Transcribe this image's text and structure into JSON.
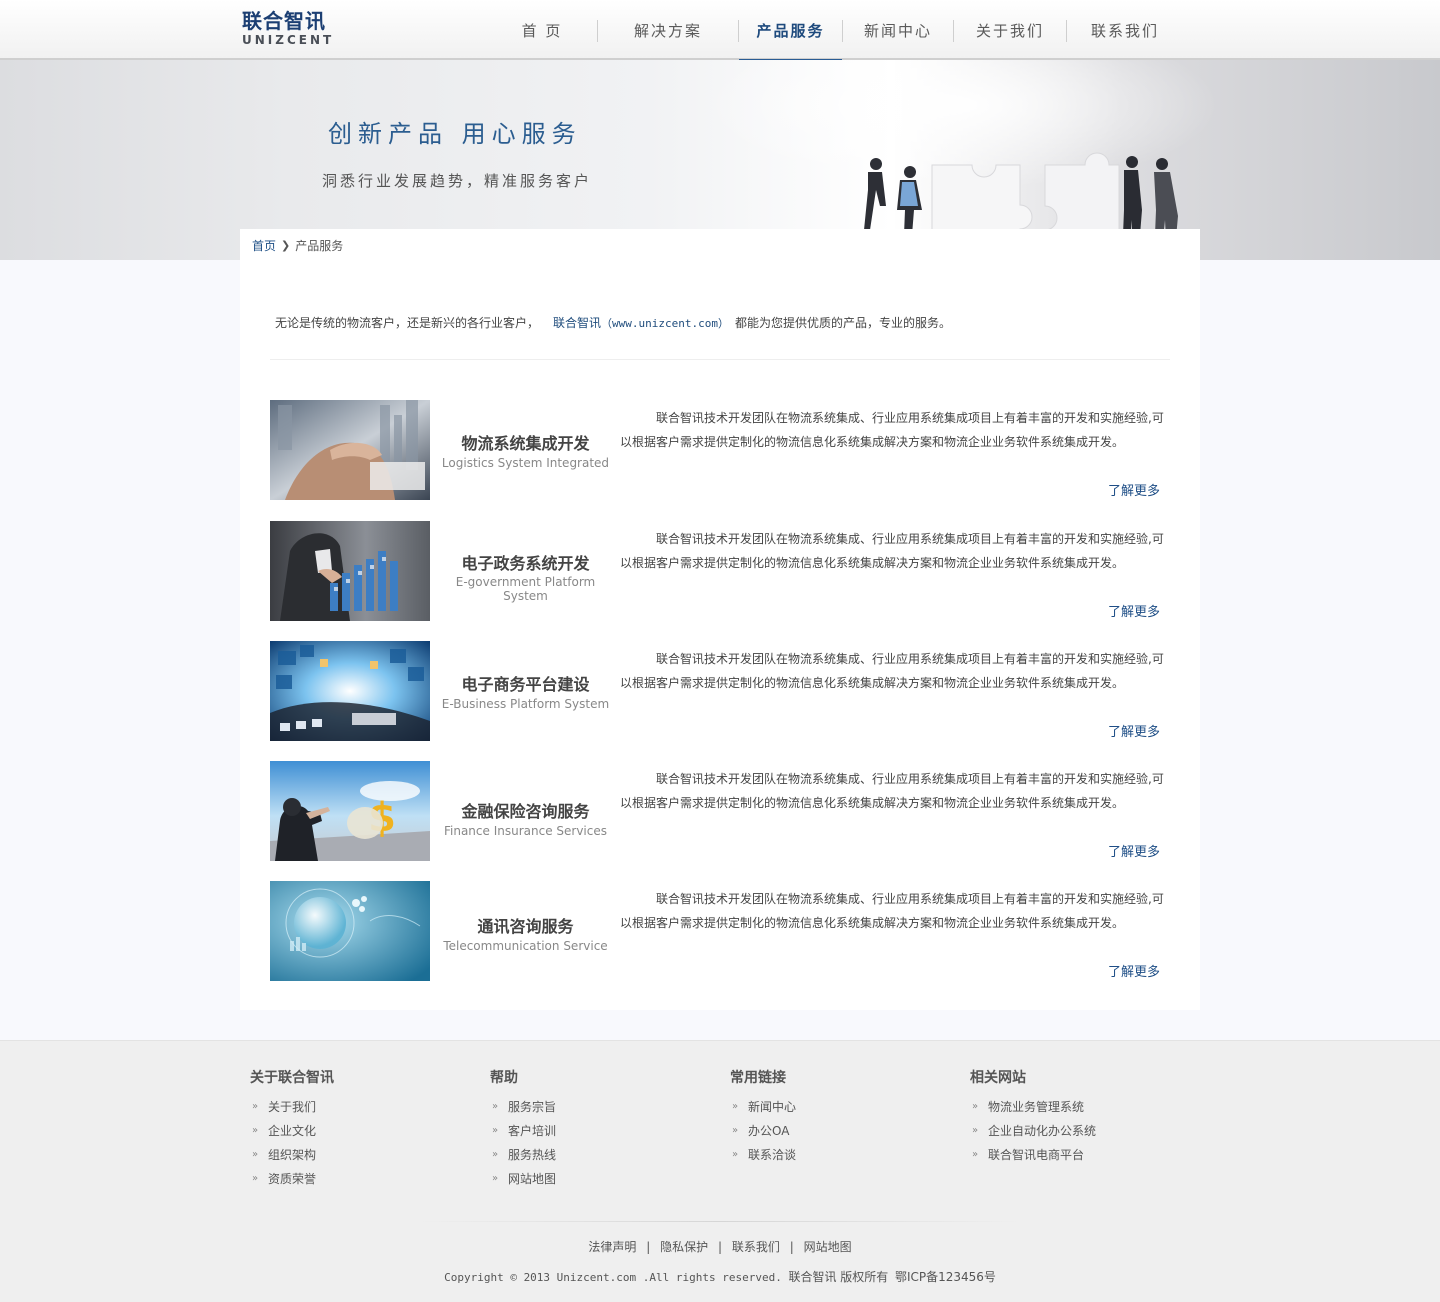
{
  "logo": {
    "cn": "联合智讯",
    "en": "UNIZCENT"
  },
  "nav": [
    {
      "label": "首 页"
    },
    {
      "label": "解决方案"
    },
    {
      "label": "产品服务",
      "active": true
    },
    {
      "label": "新闻中心"
    },
    {
      "label": "关于我们"
    },
    {
      "label": "联系我们"
    }
  ],
  "banner": {
    "slogan_main": "创新产品  用心服务",
    "slogan_sub": "洞悉行业发展趋势，精准服务客户"
  },
  "breadcrumb": {
    "home": "首页",
    "current": "产品服务"
  },
  "intro": {
    "before": "无论是传统的物流客户，还是新兴的各行业客户，",
    "brand_cn": "联合智讯",
    "brand_url": "（www.unizcent.com）",
    "after": "都能为您提供优质的产品，专业的服务。"
  },
  "services": [
    {
      "title_cn": "物流系统集成开发",
      "title_en": "Logistics System Integrated",
      "desc": "联合智讯技术开发团队在物流系统集成、行业应用系统集成项目上有着丰富的开发和实施经验,可以根据客户需求提供定制化的物流信息化系统集成解决方案和物流企业业务软件系统集成开发。",
      "more": "了解更多",
      "image": "logistics-hand-photo"
    },
    {
      "title_cn": "电子政务系统开发",
      "title_en": "E-government Platform System",
      "desc": "联合智讯技术开发团队在物流系统集成、行业应用系统集成项目上有着丰富的开发和实施经验,可以根据客户需求提供定制化的物流信息化系统集成解决方案和物流企业业务软件系统集成开发。",
      "more": "了解更多",
      "image": "egovernment-chart-photo"
    },
    {
      "title_cn": "电子商务平台建设",
      "title_en": "E-Business Platform System",
      "desc": "联合智讯技术开发团队在物流系统集成、行业应用系统集成项目上有着丰富的开发和实施经验,可以根据客户需求提供定制化的物流信息化系统集成解决方案和物流企业业务软件系统集成开发。",
      "more": "了解更多",
      "image": "ebusiness-screens-photo"
    },
    {
      "title_cn": "金融保险咨询服务",
      "title_en": "Finance Insurance Services",
      "desc": "联合智讯技术开发团队在物流系统集成、行业应用系统集成项目上有着丰富的开发和实施经验,可以根据客户需求提供定制化的物流信息化系统集成解决方案和物流企业业务软件系统集成开发。",
      "more": "了解更多",
      "image": "finance-dollar-photo"
    },
    {
      "title_cn": "通讯咨询服务",
      "title_en": "Telecommunication  Service",
      "desc": "联合智讯技术开发团队在物流系统集成、行业应用系统集成项目上有着丰富的开发和实施经验,可以根据客户需求提供定制化的物流信息化系统集成解决方案和物流企业业务软件系统集成开发。",
      "more": "了解更多",
      "image": "telecom-globe-photo"
    }
  ],
  "footer": {
    "columns": [
      {
        "title": "关于联合智讯",
        "links": [
          "关于我们",
          "企业文化",
          "组织架构",
          "资质荣誉"
        ]
      },
      {
        "title": "帮助",
        "links": [
          "服务宗旨",
          "客户培训",
          "服务热线",
          "网站地图"
        ]
      },
      {
        "title": "常用链接",
        "links": [
          "新闻中心",
          "办公OA",
          "联系洽谈"
        ]
      },
      {
        "title": "相关网站",
        "links": [
          "物流业务管理系统",
          "企业自动化办公系统",
          "联合智讯电商平台"
        ]
      }
    ],
    "bottom_links": [
      "法律声明",
      "隐私保护",
      "联系我们",
      "网站地图"
    ],
    "separator": "|",
    "copyright": "Copyright © 2013  Unizcent.com .All rights reserved.",
    "owner": "联合智讯 版权所有",
    "icp": "鄂ICP备123456号"
  },
  "colors": {
    "brand": "#1c3f73",
    "link": "#1e4e86",
    "accent": "#2a5c94"
  },
  "icons": {
    "breadcrumb_sep": "chevron-right-icon",
    "footer_bullet": "double-chevron-icon"
  }
}
